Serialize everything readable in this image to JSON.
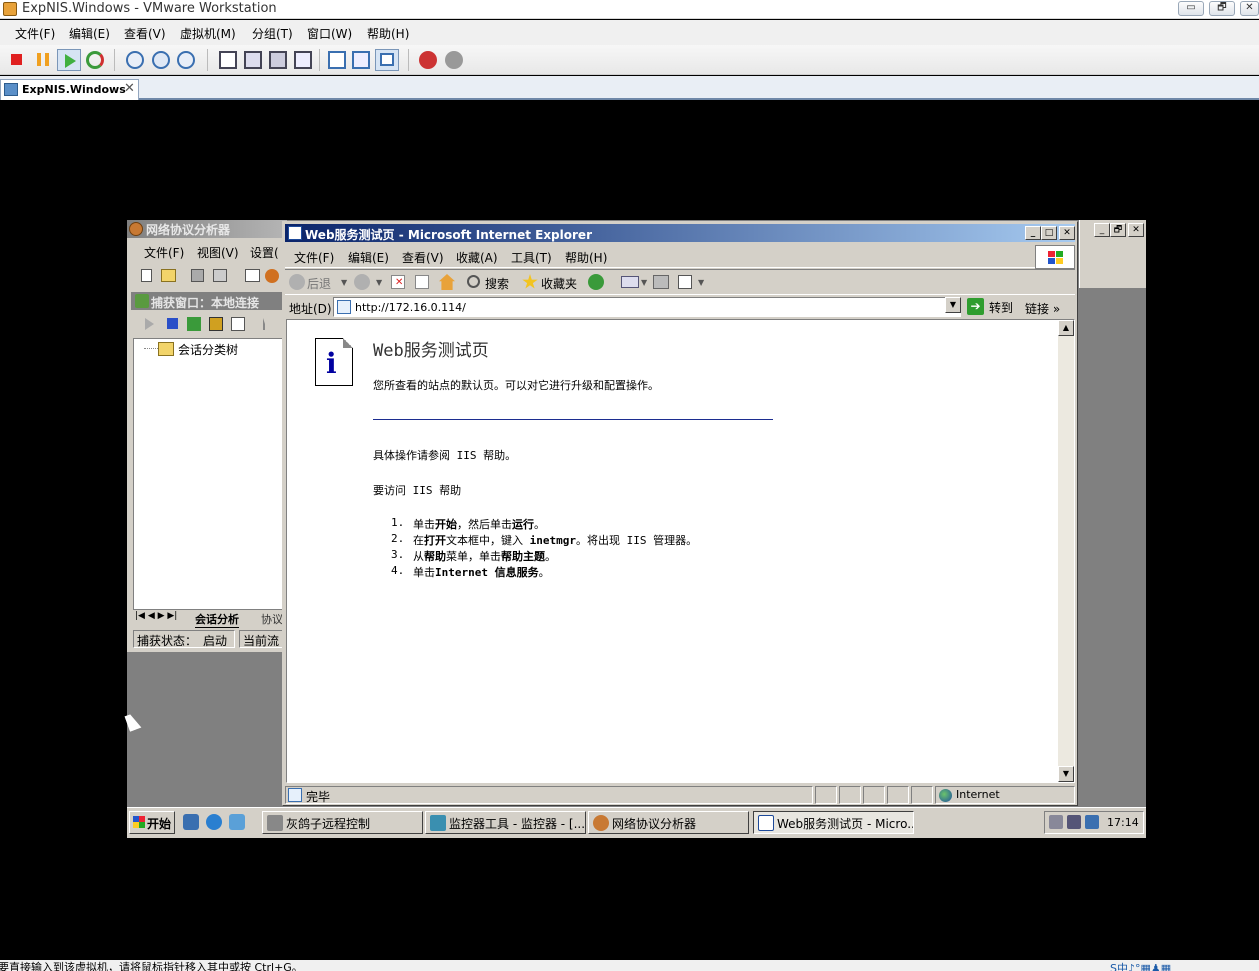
{
  "vmware": {
    "window_title": "ExpNIS.Windows - VMware Workstation",
    "window_controls": {
      "minimize": "▭",
      "restore": "🗗",
      "close": "✕"
    },
    "menu": [
      "文件(F)",
      "编辑(E)",
      "查看(V)",
      "虚拟机(M)",
      "分组(T)",
      "窗口(W)",
      "帮助(H)"
    ],
    "tab": {
      "label": "ExpNIS.Windows",
      "close": "✕"
    },
    "status_text": "要直接输入到该虚拟机，请将鼠标指针移入其中或按 Ctrl+G。",
    "status_icons": "S中♪°▦♟▦"
  },
  "guest": {
    "analyzer": {
      "title": "网络协议分析器",
      "menu": [
        "文件(F)",
        "视图(V)",
        "设置("
      ],
      "capture_title": "捕获窗口：本地连接",
      "tree_root": "会话分类树",
      "tabs": {
        "nav": "|◀ ◀ ▶ ▶|",
        "active": "会话分析",
        "other": "协议"
      },
      "status": {
        "state_label": "捕获状态：",
        "state_value": "启动",
        "current": "当前流"
      }
    },
    "ie": {
      "title": "Web服务测试页 - Microsoft Internet Explorer",
      "controls": {
        "minimize": "_",
        "maximize": "□",
        "close": "✕"
      },
      "menu": [
        "文件(F)",
        "编辑(E)",
        "查看(V)",
        "收藏(A)",
        "工具(T)",
        "帮助(H)"
      ],
      "toolbar": {
        "back": "后退",
        "search": "搜索",
        "favorites": "收藏夹"
      },
      "address": {
        "label": "地址(D)",
        "url": "http://172.16.0.114/",
        "go": "转到",
        "links": "链接",
        "more": "»"
      },
      "page": {
        "heading": "Web服务测试页",
        "subtitle": "您所查看的站点的默认页。可以对它进行升级和配置操作。",
        "para1": "具体操作请参阅 IIS 帮助。",
        "para2": "要访问 IIS 帮助",
        "steps": [
          {
            "num": "1.",
            "a": "单击",
            "b": "开始",
            "c": "，然后单击",
            "d": "运行",
            "e": "。"
          },
          {
            "num": "2.",
            "a": "在",
            "b": "打开",
            "c": "文本框中，键入 ",
            "d": "inetmgr",
            "e": "。将出现 IIS 管理器。"
          },
          {
            "num": "3.",
            "a": "从",
            "b": "帮助",
            "c": "菜单，单击",
            "d": "帮助主题",
            "e": "。"
          },
          {
            "num": "4.",
            "a": "单击",
            "b": "Internet 信息服务",
            "c": "",
            "d": "",
            "e": "。"
          }
        ]
      },
      "status": {
        "text": "完毕",
        "zone": "Internet"
      }
    },
    "bg_window_controls": {
      "minimize": "_",
      "restore": "🗗",
      "close": "✕"
    },
    "taskbar": {
      "start": "开始",
      "tasks": [
        {
          "label": "灰鸽子远程控制"
        },
        {
          "label": "监控器工具 - 监控器 - [..."
        },
        {
          "label": "网络协议分析器"
        },
        {
          "label": "Web服务测试页 - Micro..."
        }
      ],
      "clock": "17:14"
    }
  }
}
